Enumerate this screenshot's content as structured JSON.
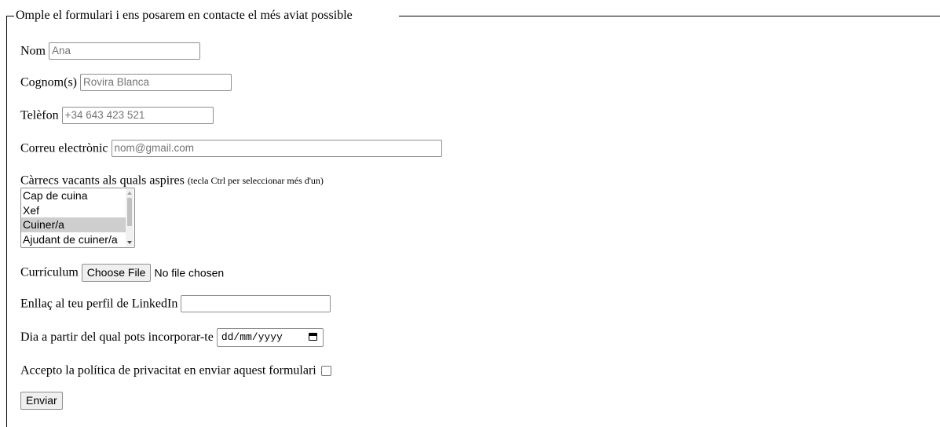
{
  "form": {
    "legend": "Omple el formulari i ens posarem en contacte el més aviat possible",
    "nom": {
      "label": "Nom",
      "value": "Ana"
    },
    "cognoms": {
      "label": "Cognom(s)",
      "value": "Rovira Blanca"
    },
    "telefon": {
      "label": "Telèfon",
      "value": "+34 643 423 521"
    },
    "correu": {
      "label": "Correu electrònic",
      "placeholder": "nom@gmail.com"
    },
    "carrecs": {
      "label": "Càrrecs vacants als quals aspires",
      "hint": "(tecla Ctrl per seleccionar més d'un)",
      "options": [
        "Cap de cuina",
        "Xef",
        "Cuiner/a",
        "Ajudant de cuiner/a"
      ],
      "selected": "Cuiner/a"
    },
    "curriculum": {
      "label": "Currículum",
      "button": "Choose File",
      "status": "No file chosen"
    },
    "linkedin": {
      "label": "Enllaç al teu perfil de LinkedIn",
      "value": ""
    },
    "dia": {
      "label": "Dia a partir del qual pots incorporar-te",
      "placeholder": "dd/mm/yyyy",
      "icon": "calendar-icon"
    },
    "privacitat": {
      "label": "Accepto la política de privacitat en enviar aquest formulari",
      "checked": false
    },
    "submit": "Enviar"
  }
}
